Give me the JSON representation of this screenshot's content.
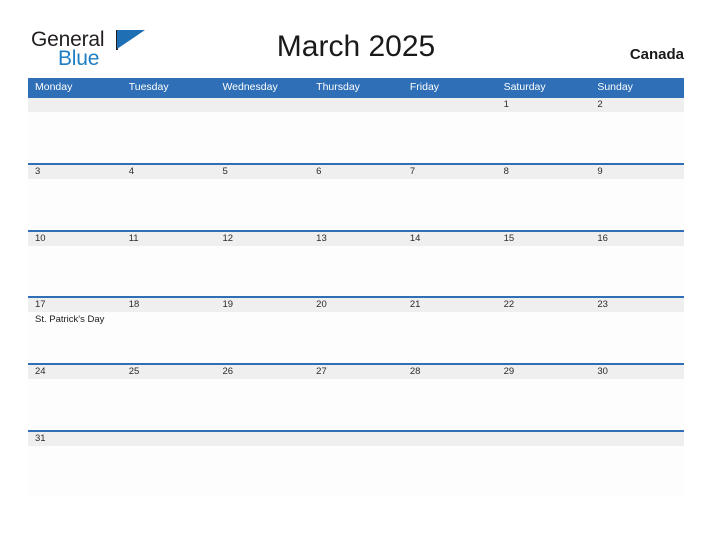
{
  "brand": {
    "name_part1": "General",
    "name_part2": "Blue"
  },
  "header": {
    "title": "March 2025",
    "country": "Canada"
  },
  "colors": {
    "header_blue": "#2e6fb7",
    "row_divider_blue": "#2e6fb7",
    "date_band_gray": "#efefef",
    "logo_blue": "#1f7fc4",
    "text_dark": "#1a1a1a"
  },
  "calendar": {
    "weekdays": [
      "Monday",
      "Tuesday",
      "Wednesday",
      "Thursday",
      "Friday",
      "Saturday",
      "Sunday"
    ],
    "weeks": [
      [
        {
          "date": "",
          "event": ""
        },
        {
          "date": "",
          "event": ""
        },
        {
          "date": "",
          "event": ""
        },
        {
          "date": "",
          "event": ""
        },
        {
          "date": "",
          "event": ""
        },
        {
          "date": "1",
          "event": ""
        },
        {
          "date": "2",
          "event": ""
        }
      ],
      [
        {
          "date": "3",
          "event": ""
        },
        {
          "date": "4",
          "event": ""
        },
        {
          "date": "5",
          "event": ""
        },
        {
          "date": "6",
          "event": ""
        },
        {
          "date": "7",
          "event": ""
        },
        {
          "date": "8",
          "event": ""
        },
        {
          "date": "9",
          "event": ""
        }
      ],
      [
        {
          "date": "10",
          "event": ""
        },
        {
          "date": "11",
          "event": ""
        },
        {
          "date": "12",
          "event": ""
        },
        {
          "date": "13",
          "event": ""
        },
        {
          "date": "14",
          "event": ""
        },
        {
          "date": "15",
          "event": ""
        },
        {
          "date": "16",
          "event": ""
        }
      ],
      [
        {
          "date": "17",
          "event": "St. Patrick's Day"
        },
        {
          "date": "18",
          "event": ""
        },
        {
          "date": "19",
          "event": ""
        },
        {
          "date": "20",
          "event": ""
        },
        {
          "date": "21",
          "event": ""
        },
        {
          "date": "22",
          "event": ""
        },
        {
          "date": "23",
          "event": ""
        }
      ],
      [
        {
          "date": "24",
          "event": ""
        },
        {
          "date": "25",
          "event": ""
        },
        {
          "date": "26",
          "event": ""
        },
        {
          "date": "27",
          "event": ""
        },
        {
          "date": "28",
          "event": ""
        },
        {
          "date": "29",
          "event": ""
        },
        {
          "date": "30",
          "event": ""
        }
      ],
      [
        {
          "date": "31",
          "event": ""
        },
        {
          "date": "",
          "event": ""
        },
        {
          "date": "",
          "event": ""
        },
        {
          "date": "",
          "event": ""
        },
        {
          "date": "",
          "event": ""
        },
        {
          "date": "",
          "event": ""
        },
        {
          "date": "",
          "event": ""
        }
      ]
    ]
  }
}
